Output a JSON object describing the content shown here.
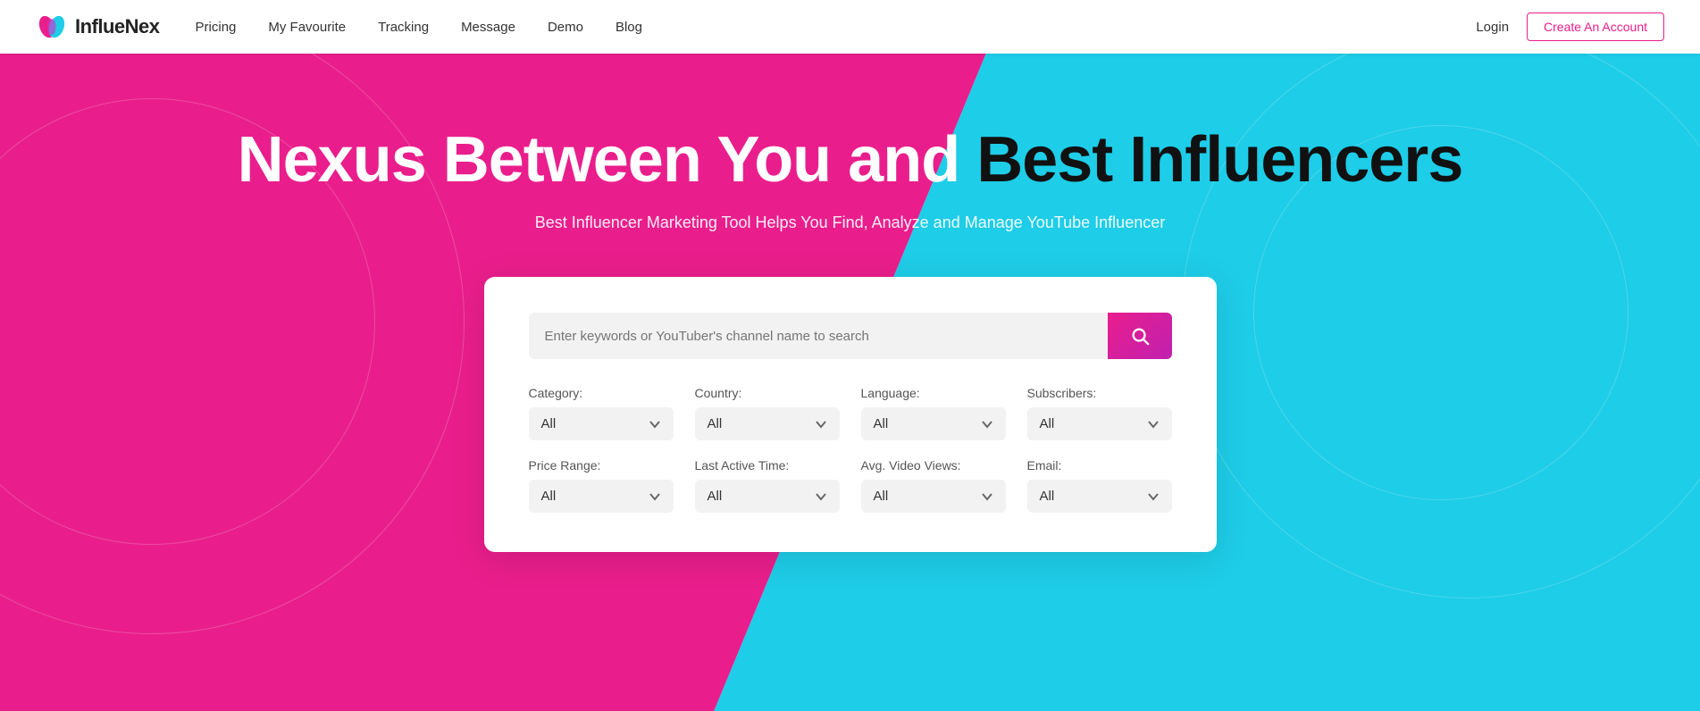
{
  "navbar": {
    "logo_text": "InflueNex",
    "links": [
      {
        "label": "Pricing",
        "id": "pricing"
      },
      {
        "label": "My Favourite",
        "id": "my-favourite"
      },
      {
        "label": "Tracking",
        "id": "tracking"
      },
      {
        "label": "Message",
        "id": "message"
      },
      {
        "label": "Demo",
        "id": "demo"
      },
      {
        "label": "Blog",
        "id": "blog"
      }
    ],
    "login_label": "Login",
    "create_account_label": "Create An Account"
  },
  "hero": {
    "title_part1": "Nexus Between You and ",
    "title_part2": "Best Influencers",
    "subtitle": "Best Influencer Marketing Tool Helps You Find, Analyze and Manage YouTube Influencer"
  },
  "search": {
    "placeholder": "Enter keywords or YouTuber's channel name to search",
    "button_label": "Search"
  },
  "filters": {
    "row1": [
      {
        "id": "category",
        "label": "Category:",
        "value": "All"
      },
      {
        "id": "country",
        "label": "Country:",
        "value": "All"
      },
      {
        "id": "language",
        "label": "Language:",
        "value": "All"
      },
      {
        "id": "subscribers",
        "label": "Subscribers:",
        "value": "All"
      }
    ],
    "row2": [
      {
        "id": "price-range",
        "label": "Price Range:",
        "value": "All"
      },
      {
        "id": "last-active-time",
        "label": "Last Active Time:",
        "value": "All"
      },
      {
        "id": "avg-video-views",
        "label": "Avg. Video Views:",
        "value": "All"
      },
      {
        "id": "email",
        "label": "Email:",
        "value": "All"
      }
    ]
  },
  "colors": {
    "pink": "#e91e8c",
    "cyan": "#1ecde8",
    "accent_gradient_start": "#e91e8c",
    "accent_gradient_end": "#c020b0"
  }
}
